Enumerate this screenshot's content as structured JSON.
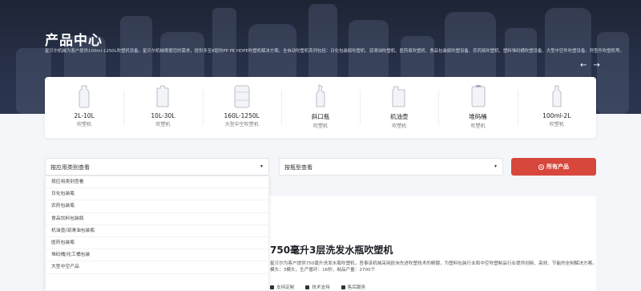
{
  "hero": {
    "title": "产品中心",
    "description": "星贝尔机械为客户提供100ml-1250L吹塑机设备。星贝尔机械根据您的需求，提供多至8层的PP PE HDPE吹塑机解决方案。全自动吹塑机系列包括：日化包装瓶吹塑机、润滑油吹塑机、医药瓶吹塑机、食品包装瓶吹塑设备、农药瓶吹塑机、塑料堆码桶吹塑设备、大型中空件吹塑设备、异型件吹塑机等。",
    "prev_arrow": "←",
    "next_arrow": "→"
  },
  "categories": [
    {
      "name": "2L-10L",
      "sub": "吹塑机",
      "icon": "bottle-2l-icon"
    },
    {
      "name": "10L-30L",
      "sub": "吹塑机",
      "icon": "jerrycan-icon"
    },
    {
      "name": "160L-1250L",
      "sub": "大型中空吹塑机",
      "icon": "drum-icon"
    },
    {
      "name": "斜口瓶",
      "sub": "吹塑机",
      "icon": "slanted-bottle-icon"
    },
    {
      "name": "机油壶",
      "sub": "吹塑机",
      "icon": "oil-can-icon"
    },
    {
      "name": "堆码桶",
      "sub": "吹塑机",
      "icon": "stacking-bucket-icon"
    },
    {
      "name": "100ml-2L",
      "sub": "吹塑机",
      "icon": "small-bottle-icon"
    }
  ],
  "filters": {
    "application_label": "按应用类别查看",
    "bottle_label": "按瓶型查看",
    "all_products_label": "所有产品",
    "caret": "▾"
  },
  "dropdown_items": [
    "按应用类别查看",
    "日化包装瓶",
    "农药包装瓶",
    "食品饮料包装瓶",
    "机油壶/润滑油包装瓶",
    "医药包装瓶",
    "堆码桶/化工桶包装",
    "大型中空产品"
  ],
  "product": {
    "title": "750毫升3层洗发水瓶吹塑机",
    "description": "星贝尔为客户提供750毫升洗发水瓶吹塑机，吾事该机械采用欧洲先进吹塑技术的精髓，为塑料包装行业和中空吹塑制品行业提供创新、高效、节能的全制解决方案。模头：3模头，生产循环：16秒，制品产量：2700个",
    "tags": [
      "支持定制",
      "技术支持",
      "售后服务"
    ]
  },
  "colors": {
    "accent": "#d7473c",
    "hero_bg": "#1d2434"
  }
}
